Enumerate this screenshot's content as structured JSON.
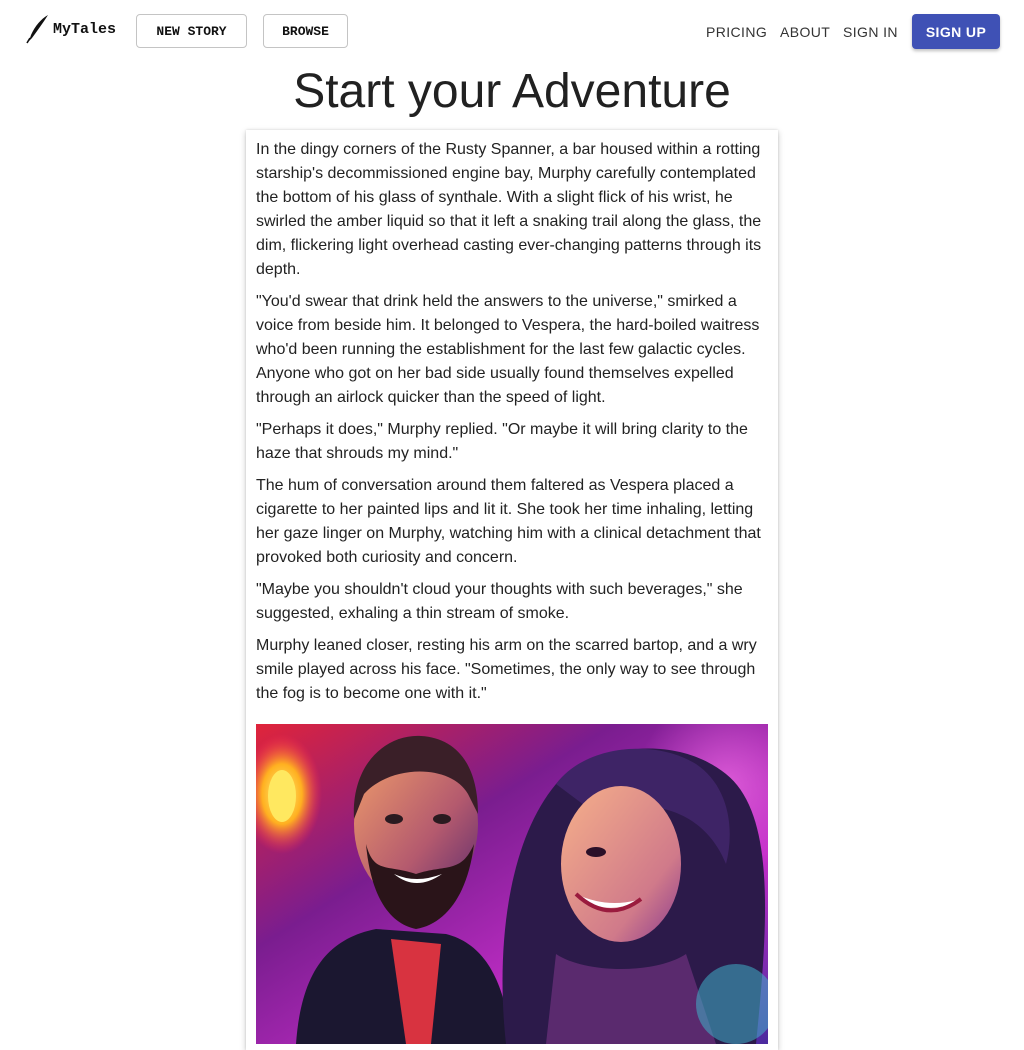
{
  "header": {
    "brand": "MyTales",
    "new_story_label": "NEW STORY",
    "browse_label": "BROWSE",
    "nav": {
      "pricing": "PRICING",
      "about": "ABOUT",
      "sign_in": "SIGN IN",
      "sign_up": "SIGN UP"
    },
    "accent_color": "#3f51b5"
  },
  "page": {
    "title": "Start your Adventure"
  },
  "story": {
    "paragraphs": [
      "In the dingy corners of the Rusty Spanner, a bar housed within a rotting starship's decommissioned engine bay, Murphy carefully contemplated the bottom of his glass of synthale. With a slight flick of his wrist, he swirled the amber liquid so that it left a snaking trail along the glass, the dim, flickering light overhead casting ever-changing patterns through its depth.",
      "\"You'd swear that drink held the answers to the universe,\" smirked a voice from beside him. It belonged to Vespera, the hard-boiled waitress who'd been running the establishment for the last few galactic cycles. Anyone who got on her bad side usually found themselves expelled through an airlock quicker than the speed of light.",
      "\"Perhaps it does,\" Murphy replied. \"Or maybe it will bring clarity to the haze that shrouds my mind.\"",
      "The hum of conversation around them faltered as Vespera placed a cigarette to her painted lips and lit it. She took her time inhaling, letting her gaze linger on Murphy, watching him with a clinical detachment that provoked both curiosity and concern.",
      "\"Maybe you shouldn't cloud your thoughts with such beverages,\" she suggested, exhaling a thin stream of smoke.",
      "Murphy leaned closer, resting his arm on the scarred bartop, and a wry smile played across his face. \"Sometimes, the only way to see through the fog is to become one with it.\""
    ]
  },
  "icons": {
    "logo": "quill-icon"
  }
}
